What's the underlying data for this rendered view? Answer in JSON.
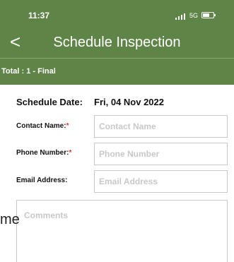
{
  "status_bar": {
    "time": "11:37",
    "network": "5G",
    "icons": [
      "signal-icon",
      "battery-icon"
    ]
  },
  "header": {
    "back_icon": "chevron-left-icon",
    "back_glyph": "<",
    "title": "Schedule Inspection",
    "subtitle": "Total : 1 - Final",
    "background_color": "#5f8448"
  },
  "form": {
    "schedule_date": {
      "label": "Schedule Date:",
      "value": "Fri, 04 Nov 2022"
    },
    "contact_name": {
      "label": "Contact Name:",
      "required_mark": "*",
      "placeholder": "Contact Name",
      "value": ""
    },
    "phone_number": {
      "label": "Phone Number:",
      "required_mark": "*",
      "placeholder": "Phone Number",
      "value": ""
    },
    "email_address": {
      "label": "Email Address:",
      "placeholder": "Email Address",
      "value": ""
    },
    "comments": {
      "placeholder": "Comments",
      "value": ""
    },
    "overflow_label": "me",
    "required_color": "#d83a3a"
  }
}
